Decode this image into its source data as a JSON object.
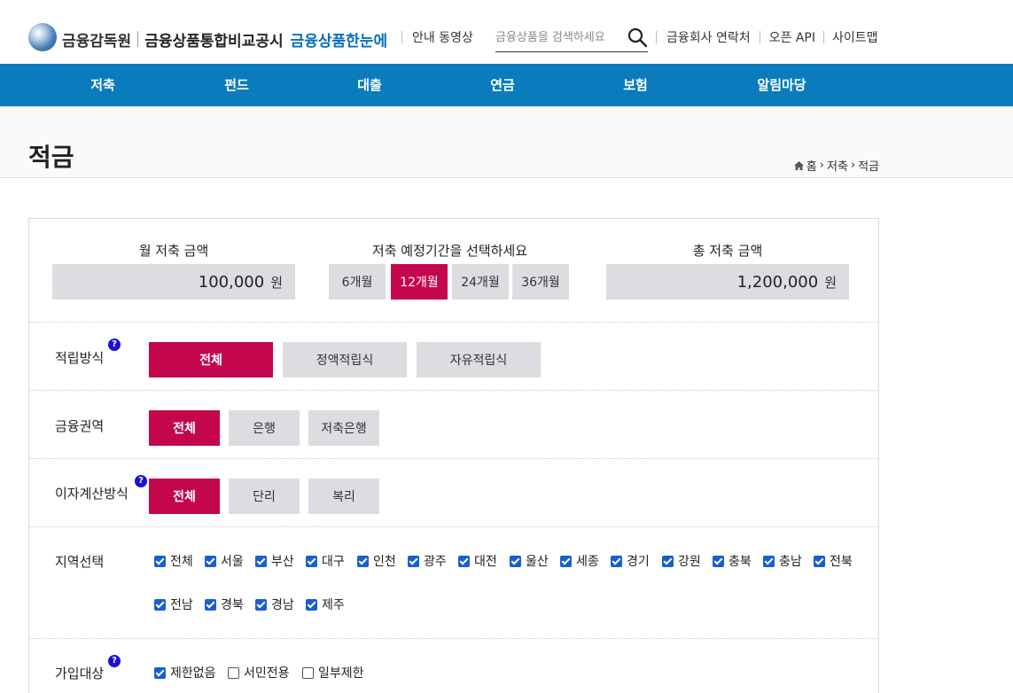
{
  "header": {
    "logo_org": "금융감독원",
    "logo_title": "금융상품통합비교공시",
    "logo_sub": "금융상품한눈에",
    "guide_video": "안내 동영상",
    "search_placeholder": "금융상품을 검색하세요",
    "contacts": "금융회사 연락처",
    "open_api": "오픈 API",
    "sitemap": "사이트맵"
  },
  "nav": [
    "저축",
    "펀드",
    "대출",
    "연금",
    "보험",
    "알림마당"
  ],
  "page": {
    "title": "적금",
    "breadcrumb": [
      "홈",
      "저축",
      "적금"
    ]
  },
  "calc": {
    "monthly_label": "월 저축 금액",
    "monthly_value": "100,000",
    "unit": "원",
    "period_label": "저축 예정기간을 선택하세요",
    "periods": [
      "6개월",
      "12개월",
      "24개월",
      "36개월"
    ],
    "selected_period": "12개월",
    "total_label": "총 저축 금액",
    "total_value": "1,200,000"
  },
  "filters": {
    "method": {
      "label": "적립방식",
      "options": [
        "전체",
        "정액적립식",
        "자유적립식"
      ],
      "selected": "전체"
    },
    "sector": {
      "label": "금융권역",
      "options": [
        "전체",
        "은행",
        "저축은행"
      ],
      "selected": "전체"
    },
    "interest": {
      "label": "이자계산방식",
      "options": [
        "전체",
        "단리",
        "복리"
      ],
      "selected": "전체"
    },
    "region": {
      "label": "지역선택",
      "items": [
        "전체",
        "서울",
        "부산",
        "대구",
        "인천",
        "광주",
        "대전",
        "울산",
        "세종",
        "경기",
        "강원",
        "충북",
        "충남",
        "전북",
        "전남",
        "경북",
        "경남",
        "제주"
      ],
      "checked": [
        true,
        true,
        true,
        true,
        true,
        true,
        true,
        true,
        true,
        true,
        true,
        true,
        true,
        true,
        true,
        true,
        true,
        true
      ]
    },
    "target": {
      "label": "가입대상",
      "items": [
        "제한없음",
        "서민전용",
        "일부제한"
      ],
      "checked": [
        true,
        false,
        false
      ]
    }
  },
  "help_glyph": "?",
  "colors": {
    "nav_bg": "#0a7bbd",
    "accent": "#c4074d",
    "checkbox": "#1a5fd0",
    "help": "#1a0fdb"
  }
}
